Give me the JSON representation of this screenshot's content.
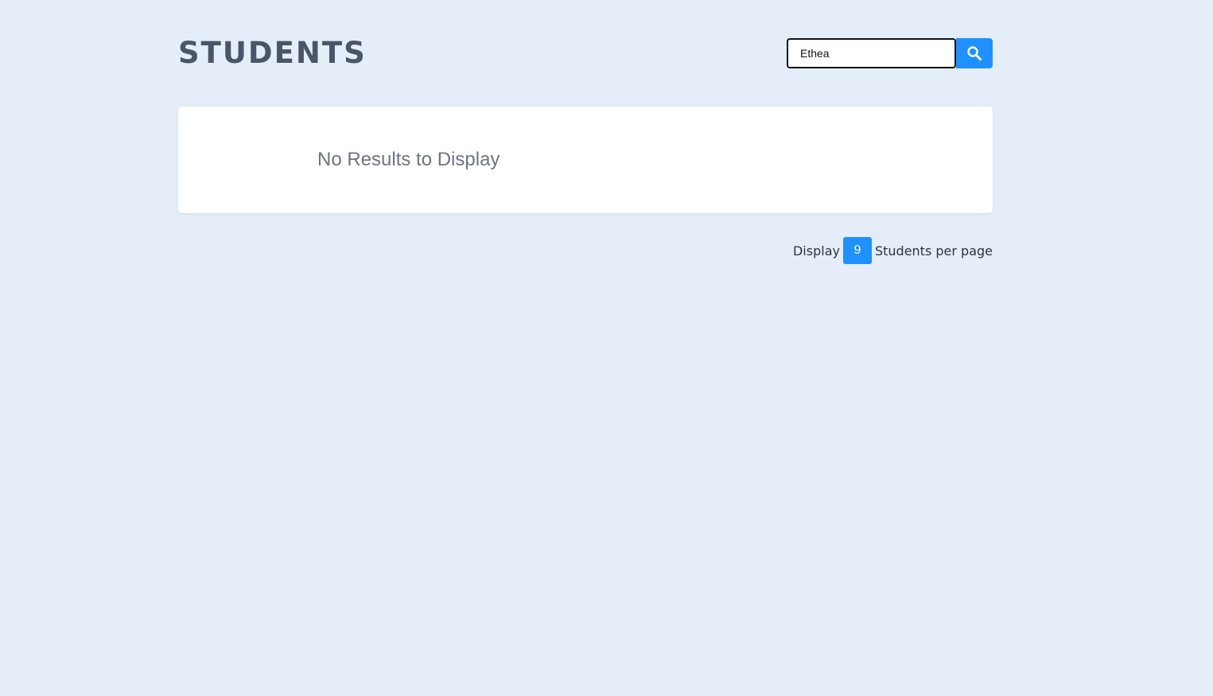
{
  "header": {
    "title": "STUDENTS"
  },
  "search": {
    "value": "Ethea",
    "button_icon": "search-icon"
  },
  "results": {
    "empty_message": "No Results to Display"
  },
  "pagination": {
    "prefix": "Display",
    "count": "9",
    "suffix": "Students per page"
  },
  "colors": {
    "background": "#e5edf9",
    "accent": "#1e90ff",
    "title": "#4a5567"
  }
}
